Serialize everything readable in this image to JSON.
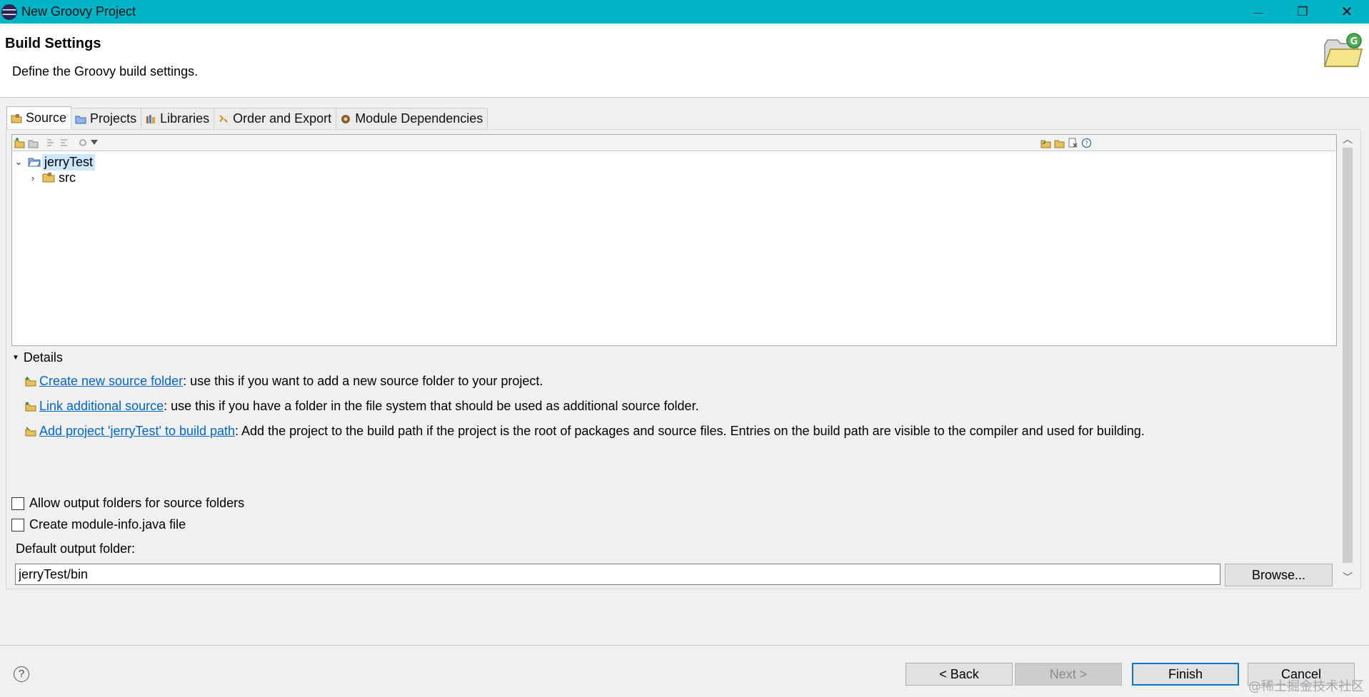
{
  "window": {
    "title": "New Groovy Project",
    "minimize_glyph": "—",
    "restore_glyph": "❐",
    "close_glyph": "✕"
  },
  "header": {
    "title": "Build Settings",
    "description": "Define the Groovy build settings.",
    "icon": "groovy-folder-icon"
  },
  "tabs": [
    {
      "label": "Source",
      "icon": "source-folder-icon",
      "active": true
    },
    {
      "label": "Projects",
      "icon": "projects-icon",
      "active": false
    },
    {
      "label": "Libraries",
      "icon": "libraries-icon",
      "active": false
    },
    {
      "label": "Order and Export",
      "icon": "order-export-icon",
      "active": false
    },
    {
      "label": "Module Dependencies",
      "icon": "module-icon",
      "active": false
    }
  ],
  "tree": {
    "items": [
      {
        "label": "jerryTest",
        "expanded": true,
        "selected": true,
        "twisty": "⌄"
      },
      {
        "label": "src",
        "expanded": false,
        "selected": false,
        "twisty": "›"
      }
    ]
  },
  "details": {
    "heading": "Details",
    "lines": [
      {
        "link": "Create new source folder",
        "text": ": use this if you want to add a new source folder to your project."
      },
      {
        "link": "Link additional source",
        "text": ": use this if you have a folder in the file system that should be used as additional source folder."
      },
      {
        "link": "Add project 'jerryTest' to build path",
        "text": ": Add the project to the build path if the project is the root of packages and source files. Entries on the build path are visible to the compiler and used for building."
      }
    ]
  },
  "options": {
    "allow_output_folders": "Allow output folders for source folders",
    "create_module_info": "Create module-info.java file"
  },
  "output": {
    "label": "Default output folder:",
    "value": "jerryTest/bin",
    "browse_label": "Browse..."
  },
  "footer": {
    "help_glyph": "?",
    "back_label": "< Back",
    "next_label": "Next >",
    "finish_label": "Finish",
    "cancel_label": "Cancel"
  },
  "watermark": "@稀土掘金技术社区",
  "colors": {
    "titlebar": "#00b4c5",
    "link": "#0066cc",
    "selection": "#cce8ff",
    "default_button_border": "#0078d7"
  }
}
